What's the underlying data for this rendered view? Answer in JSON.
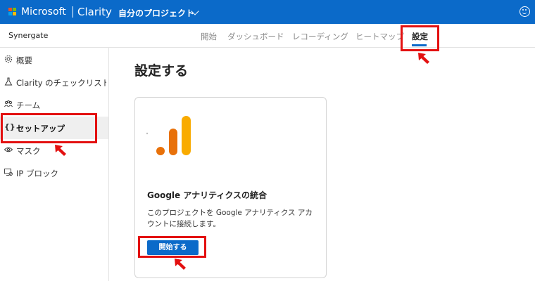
{
  "topbar": {
    "brand": "Microsoft",
    "product": "Clarity",
    "project": "自分のプロジェクト"
  },
  "subheader": {
    "workspace": "Synergate",
    "tabs": [
      {
        "label": "開始"
      },
      {
        "label": "ダッシュボード"
      },
      {
        "label": "レコーディング"
      },
      {
        "label": "ヒートマップ"
      },
      {
        "label": "設定"
      }
    ]
  },
  "sidebar": {
    "items": [
      {
        "label": "概要",
        "icon": "gear-icon"
      },
      {
        "label": "Clarity のチェックリスト",
        "icon": "flask-icon"
      },
      {
        "label": "チーム",
        "icon": "people-icon"
      },
      {
        "label": "セットアップ",
        "icon": "braces-icon"
      },
      {
        "label": "マスク",
        "icon": "eye-icon"
      },
      {
        "label": "IP ブロック",
        "icon": "monitor-block-icon"
      }
    ]
  },
  "main": {
    "title": "設定する",
    "card": {
      "icon": "google-analytics-icon",
      "title": "Google アナリティクスの統合",
      "description_line1": "このプロジェクトを Google アナリティクス アカ",
      "description_line2": "ウントに接続します。",
      "button_label": "開始する"
    }
  },
  "colors": {
    "accent": "#0b6ac9",
    "annotation": "#e31010",
    "ga_orange": "#e8710a",
    "ga_yellow": "#f9ab00"
  }
}
